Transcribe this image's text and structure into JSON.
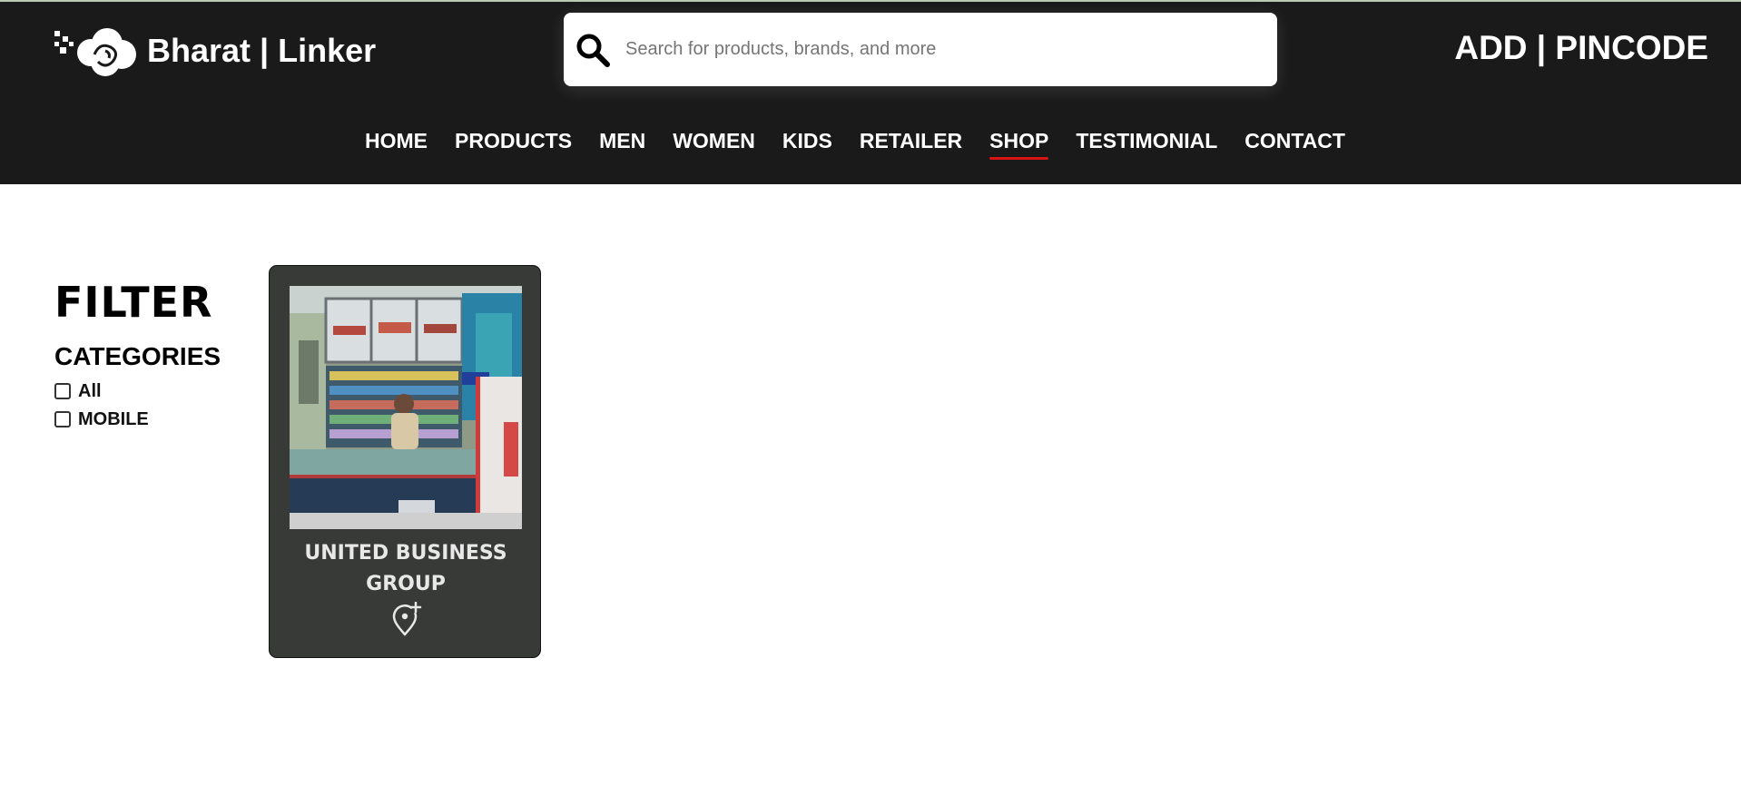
{
  "brand": {
    "name": "Bharat | Linker",
    "logo_icon": "cloud-logo-icon"
  },
  "search": {
    "placeholder": "Search for products, brands, and more",
    "value": "",
    "icon": "search-icon"
  },
  "location": {
    "label": "ADD | PINCODE"
  },
  "nav": {
    "active": "SHOP",
    "items": [
      {
        "label": "HOME"
      },
      {
        "label": "PRODUCTS"
      },
      {
        "label": "MEN"
      },
      {
        "label": "WOMEN"
      },
      {
        "label": "KIDS"
      },
      {
        "label": "RETAILER"
      },
      {
        "label": "SHOP"
      },
      {
        "label": "TESTIMONIAL"
      },
      {
        "label": "CONTACT"
      }
    ]
  },
  "filter": {
    "title": "FILTER",
    "categories_title": "CATEGORIES",
    "categories": [
      {
        "label": "All",
        "checked": false
      },
      {
        "label": "MOBILE",
        "checked": false
      }
    ]
  },
  "shops": [
    {
      "name": "UNITED BUSINESS GROUP",
      "icon": "add-location-icon"
    }
  ],
  "colors": {
    "header_bg": "#1b1a1a",
    "active_underline": "#d71313",
    "card_bg": "#383a37"
  }
}
